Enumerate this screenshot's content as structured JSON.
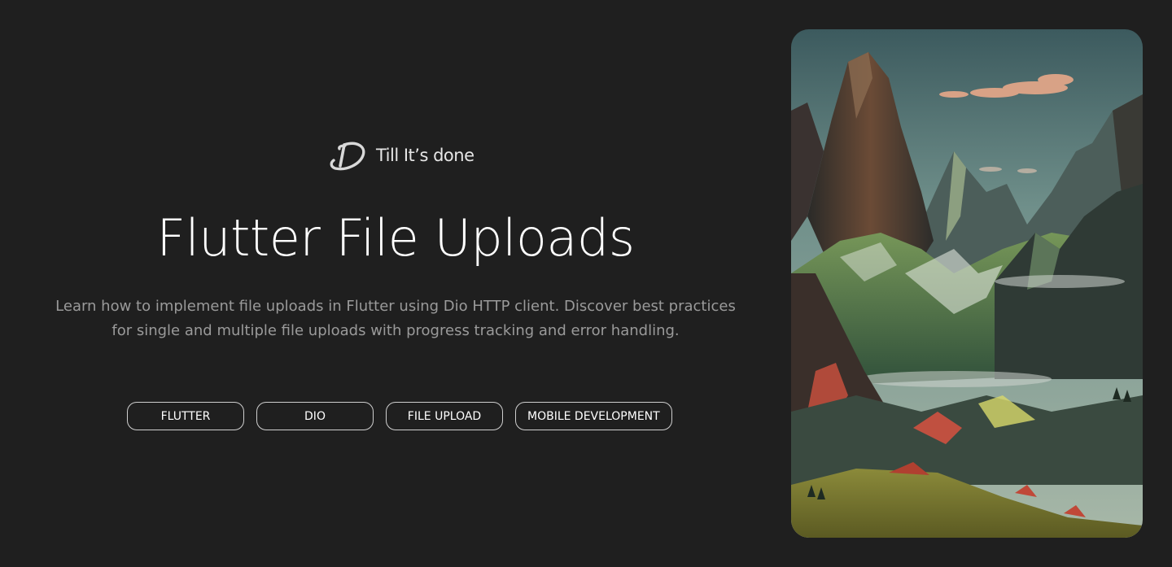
{
  "brand": {
    "name": "Till It’s done",
    "logo_icon": "brand-logo-icon"
  },
  "post": {
    "title": "Flutter File Uploads",
    "description": "Learn how to implement file uploads in Flutter using Dio HTTP client. Discover best practices for single and multiple file uploads with progress tracking and error handling."
  },
  "tags": [
    {
      "label": "FLUTTER"
    },
    {
      "label": "DIO"
    },
    {
      "label": "FILE UPLOAD"
    },
    {
      "label": "MOBILE DEVELOPMENT"
    }
  ],
  "colors": {
    "background": "#1f1f1f",
    "text_primary": "#ffffff",
    "text_muted": "#9a9a9a",
    "tag_border": "#cfcfcf"
  },
  "hero_image": {
    "subject": "mountain-landscape-illustration"
  }
}
